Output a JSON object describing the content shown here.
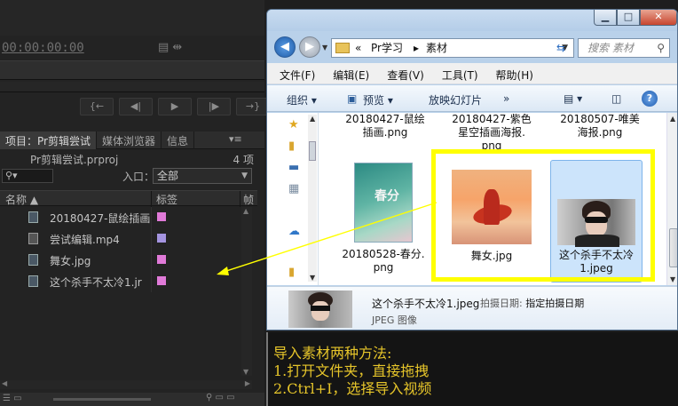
{
  "premiere": {
    "timecode": "00:00:00:00",
    "transport_icons": [
      "{←",
      "◀|",
      "▶",
      "|▶",
      "→}"
    ],
    "tabs": [
      "项目：Pr剪辑尝试",
      "媒体浏览器",
      "信息"
    ],
    "tab_menu": "▾≡",
    "project_file": "Pr剪辑尝试.prproj",
    "item_count": "4 项",
    "search_icon": "⚲▾",
    "in_label": "入口：",
    "in_value": "全部",
    "columns": {
      "name": "名称 ▲",
      "label": "标签",
      "frame": "帧"
    },
    "items": [
      {
        "name": "20180427-鼠绘插画",
        "type": "image",
        "color": "#e07ad8"
      },
      {
        "name": "尝试编辑.mp4",
        "type": "video",
        "color": "#a494e0"
      },
      {
        "name": "舞女.jpg",
        "type": "image",
        "color": "#e07ad8"
      },
      {
        "name": "这个杀手不太冷1.jr",
        "type": "image",
        "color": "#e07ad8"
      }
    ]
  },
  "explorer": {
    "window_buttons": {
      "min": "▁",
      "max": "□",
      "close": "✕"
    },
    "breadcrumb": [
      "«",
      "Pr学习",
      "▸",
      "素材"
    ],
    "search_placeholder": "搜索 素材",
    "menu": [
      "文件(F)",
      "编辑(E)",
      "查看(V)",
      "工具(T)",
      "帮助(H)"
    ],
    "toolbar": {
      "organize": "组织 ▾",
      "preview": "预览 ▾",
      "slideshow": "放映幻灯片",
      "more": "»",
      "help": "?"
    },
    "tiles": {
      "top1": "20180427-鼠绘\n插画.png",
      "top2": "20180427-紫色\n星空插画海报.\npng",
      "top3": "20180507-唯美\n海报.png",
      "green": "20180528-春分.\npng",
      "green_calligraphy": "春分",
      "dancer": "舞女.jpg",
      "leon": "这个杀手不太冷\n1.jpeg"
    },
    "details": {
      "filename": "这个杀手不太冷1.jpeg",
      "meta_label": "拍摄日期:",
      "meta_value": "指定拍摄日期",
      "filetype": "JPEG 图像"
    }
  },
  "instructions": {
    "title": "导入素材两种方法:",
    "step1": "1.打开文件夹，直接拖拽",
    "step2": "2.Ctrl+I，选择导入视频"
  },
  "colors": {
    "highlight": "#ffff00",
    "annotation_text": "#e6c52a",
    "arrow": "#ffff00"
  }
}
